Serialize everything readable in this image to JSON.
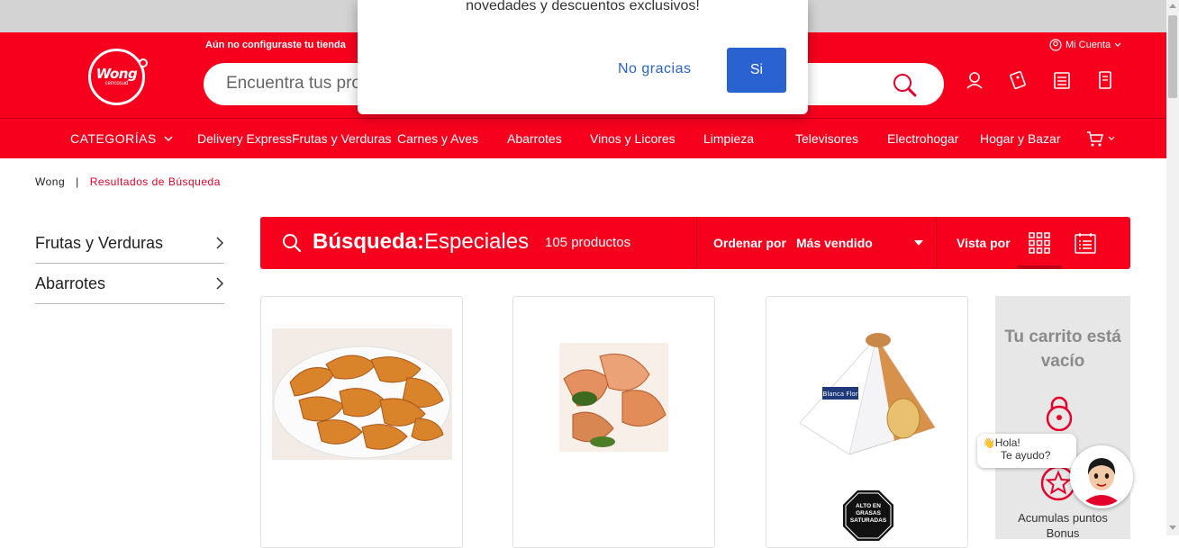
{
  "header": {
    "logo_text": "Wong",
    "logo_sub": "cencosud",
    "store_notice": "Aún no configuraste tu tienda",
    "search_placeholder": "Encuentra tus productos",
    "account_label": "Mi Cuenta",
    "icons": [
      "user-icon",
      "coupon-icon",
      "list-icon",
      "receipt-icon"
    ]
  },
  "nav": {
    "categories_label": "CATEGORÍAS",
    "items": [
      "Delivery Express",
      "Frutas y Verduras",
      "Carnes y Aves",
      "Abarrotes",
      "Vinos y Licores",
      "Limpieza",
      "Televisores",
      "Electrohogar",
      "Hogar y Bazar"
    ]
  },
  "breadcrumb": {
    "home": "Wong",
    "separator": "|",
    "current": "Resultados de Búsqueda"
  },
  "sidebar": {
    "items": [
      {
        "label": "Frutas y Verduras"
      },
      {
        "label": "Abarrotes"
      }
    ]
  },
  "results_bar": {
    "search_label": "Búsqueda:",
    "search_term": "Especiales",
    "count": "105 productos",
    "sort_label": "Ordenar por",
    "sort_value": "Más vendido",
    "view_label": "Vista por"
  },
  "products": [
    {
      "image": "fried-potato-wedges"
    },
    {
      "image": "grilled-chicken-with-herb-sauce"
    },
    {
      "image": "blanca-flor-panetón-box",
      "badge": "ALTO EN GRASAS SATURADAS"
    }
  ],
  "cart": {
    "title": "Tu carrito está vacío",
    "perk_label": "Acumulas puntos",
    "perk_label_2": "Bonus"
  },
  "chat": {
    "greeting": "Hola!",
    "help": "Te ayudo?"
  },
  "modal": {
    "message": "novedades y descuentos exclusivos!",
    "decline": "No gracias",
    "accept": "Si"
  },
  "colors": {
    "brand_red": "#f7001d",
    "accept_blue": "#2b62d2"
  }
}
